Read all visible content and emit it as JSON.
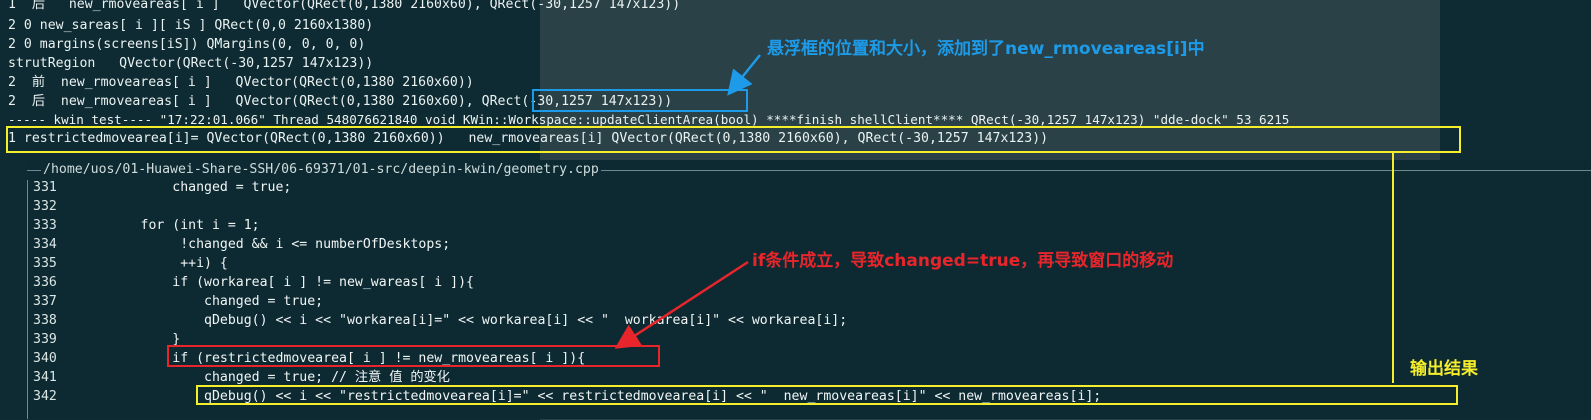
{
  "terminal_lines": [
    "1  后   new_rmoveareas[ i ]   QVector(QRect(0,1380 2160x60), QRect(-30,1257 147x123))",
    "2 0 new_sareas[ i ][ iS ] QRect(0,0 2160x1380)",
    "2 0 margins(screens[iS]) QMargins(0, 0, 0, 0)",
    "strutRegion   QVector(QRect(-30,1257 147x123))",
    "2  前  new_rmoveareas[ i ]   QVector(QRect(0,1380 2160x60))",
    "2  后  new_rmoveareas[ i ]   QVector(QRect(0,1380 2160x60), QRect(-30,1257 147x123))",
    "----- kwin_test---- \"17:22:01.066\" Thread 548076621840 void KWin::Workspace::updateClientArea(bool) ****finish shellClient**** QRect(-30,1257 147x123) \"dde-dock\" 53 6215",
    "1 restrictedmovearea[i]= QVector(QRect(0,1380 2160x60))   new_rmoveareas[i] QVector(QRect(0,1380 2160x60), QRect(-30,1257 147x123))"
  ],
  "editor": {
    "file_path": "/home/uos/01-Huawei-Share-SSH/06-69371/01-src/deepin-kwin/geometry.cpp",
    "line_numbers": [
      "331",
      "332",
      "333",
      "334",
      "335",
      "336",
      "337",
      "338",
      "339",
      "340",
      "341",
      "342"
    ],
    "code_lines": [
      "            changed = true;",
      "",
      "        for (int i = 1;",
      "             !changed && i <= numberOfDesktops;",
      "             ++i) {",
      "            if (workarea[ i ] != new_wareas[ i ]){",
      "                changed = true;",
      "                qDebug() << i << \"workarea[i]=\" << workarea[i] << \"  workarea[i]\" << workarea[i];",
      "            }",
      "            if (restrictedmovearea[ i ] != new_rmoveareas[ i ]){",
      "                changed = true; // 注意 值 的变化",
      "                qDebug() << i << \"restrictedmovearea[i]=\" << restrictedmovearea[i] << \"  new_rmoveareas[i]\" << new_rmoveareas[i];"
    ]
  },
  "annotations": {
    "blue_note": "悬浮框的位置和大小，添加到了new_rmoveareas[i]中",
    "red_note": "if条件成立，导致changed=true，再导致窗口的移动",
    "yellow_note": "输出结果"
  },
  "colors": {
    "terminal_bg": "#0e2a32",
    "accent_blue": "#1e9be8",
    "accent_red": "#e8252a",
    "accent_yellow": "#f5ee2a",
    "negative_number": "#3fb3a6"
  }
}
